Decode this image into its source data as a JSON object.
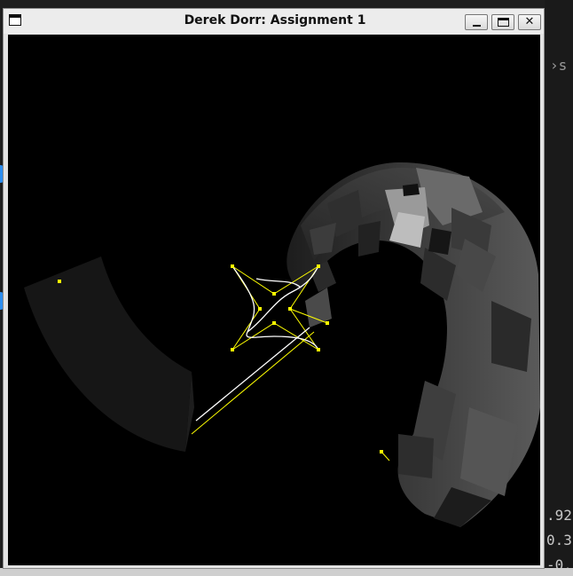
{
  "window": {
    "title": "Derek Dorr: Assignment 1",
    "minimize_glyph": "",
    "maximize_glyph": "",
    "close_glyph": "✕"
  },
  "background_editor": {
    "chevron": "›",
    "tab_fragment": "s",
    "line_1": ".92",
    "line_2": "0.3",
    "line_3": "-0."
  },
  "scene": {
    "control_point_color": "#ffff00",
    "curve_color": "#ffffff",
    "surface_color": "#2a2a2a"
  }
}
